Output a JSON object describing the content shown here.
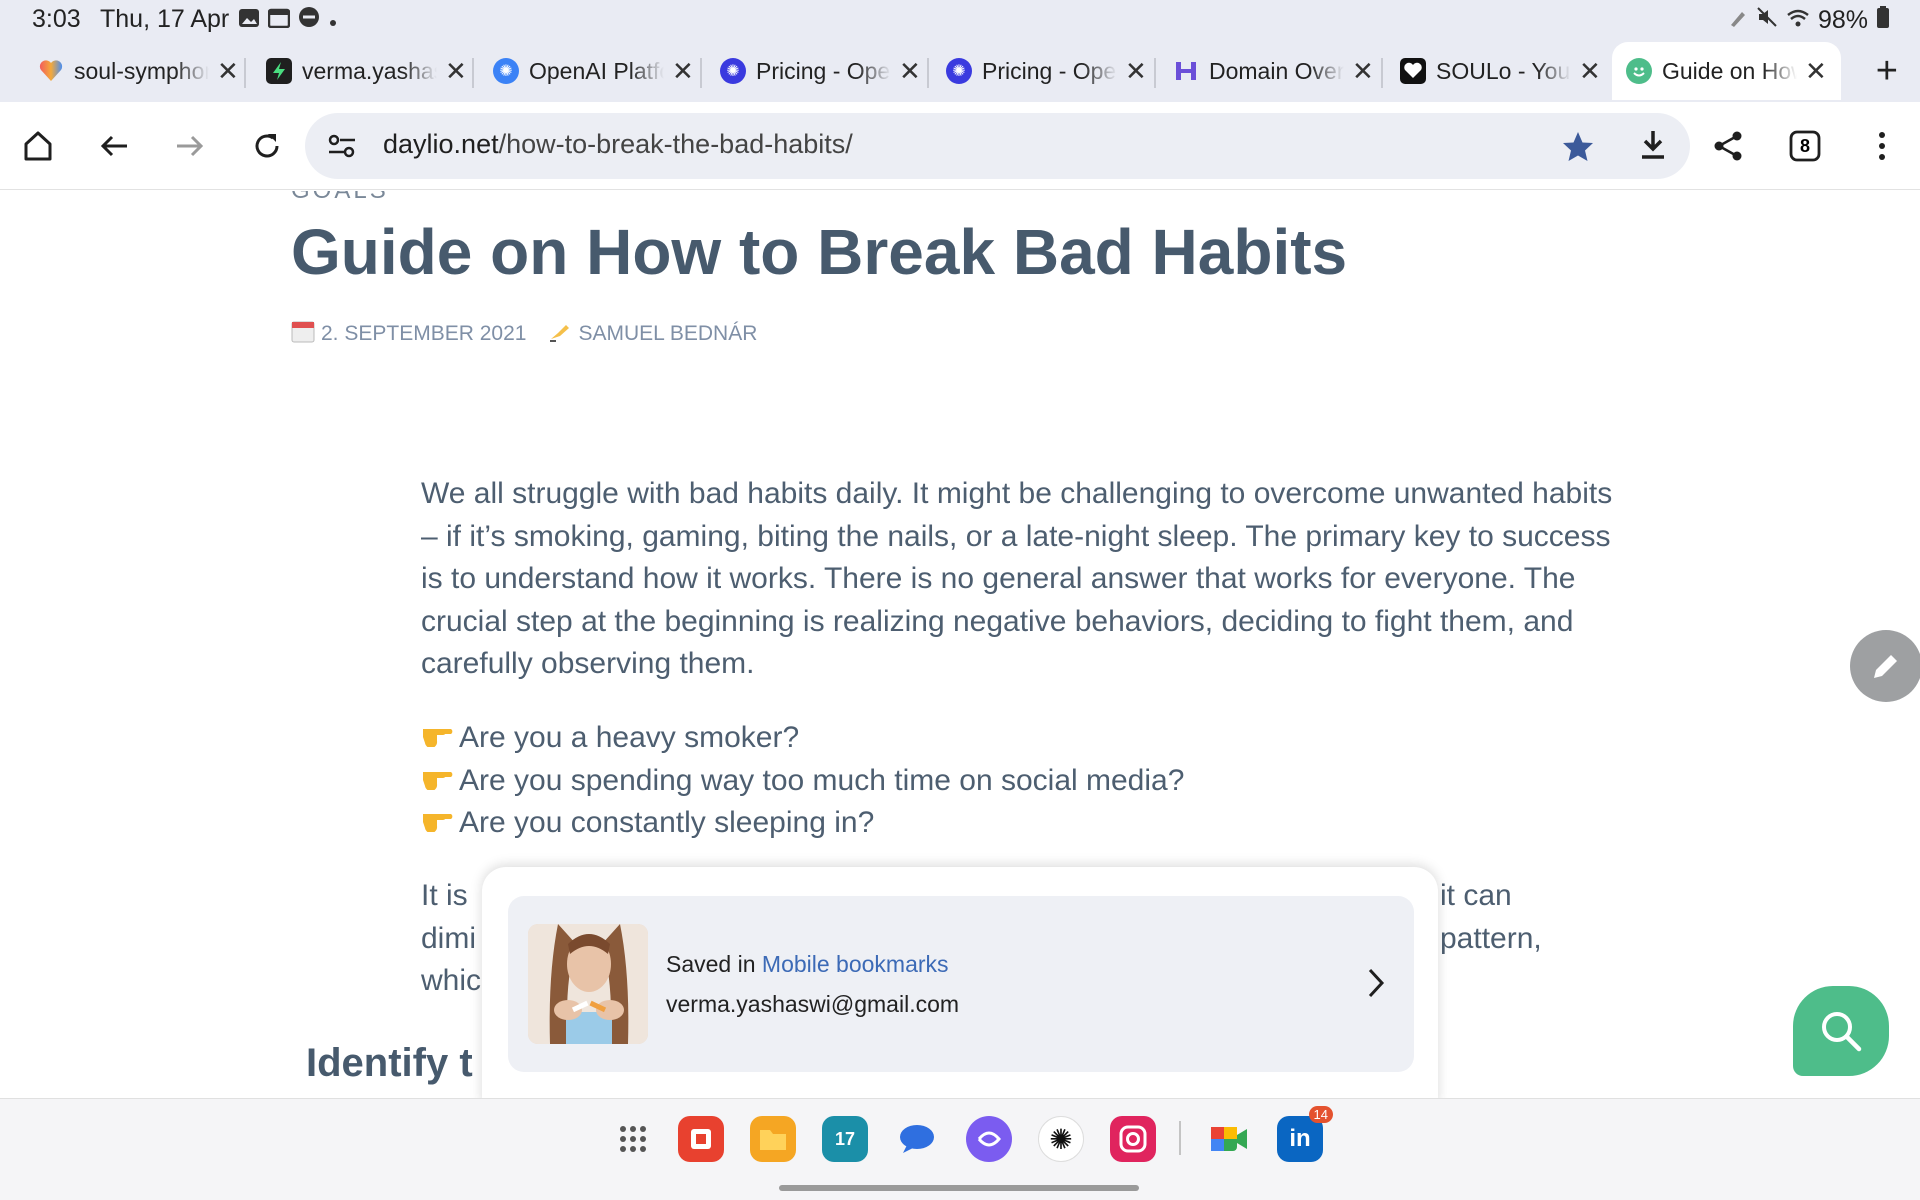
{
  "status_bar": {
    "time": "3:03",
    "date": "Thu, 17 Apr",
    "battery": "98%"
  },
  "tabs": [
    {
      "title": "soul-symphony",
      "favicon": "heart-icon",
      "color": "#e8523f"
    },
    {
      "title": "verma.yashaswi",
      "favicon": "bolt-icon",
      "color": "#1f1f1f"
    },
    {
      "title": "OpenAI Platform",
      "favicon": "openai-icon",
      "color": "#3b82f6"
    },
    {
      "title": "Pricing - OpenAI",
      "favicon": "openai-icon",
      "color": "#3a3adf"
    },
    {
      "title": "Pricing - OpenAI",
      "favicon": "openai-icon",
      "color": "#3a3adf"
    },
    {
      "title": "Domain Overview",
      "favicon": "semrush-icon",
      "color": "#6b4fd8"
    },
    {
      "title": "SOULo - Your",
      "favicon": "heart-outline-icon",
      "color": "#111111"
    },
    {
      "title": "Guide on How",
      "favicon": "daylio-icon",
      "color": "#4ebd8a"
    }
  ],
  "toolbar": {
    "url_domain": "daylio.net",
    "url_path": "/how-to-break-the-bad-habits/",
    "tab_count": "8"
  },
  "article": {
    "category": "GOALS",
    "title": "Guide on How to Break Bad Habits",
    "date": "2. SEPTEMBER 2021",
    "author": "SAMUEL BEDNÁR",
    "paragraph1": "We all struggle with bad habits daily. It might be challenging to overcome unwanted habits – if it’s smoking, gaming, biting the nails, or a late-night sleep. The primary key to success is to understand how it works. There is no general answer that works for everyone. The crucial step at the beginning is realizing negative behaviors, deciding to fight them, and carefully observing them.",
    "bullets": [
      "Are you a heavy smoker?",
      "Are you spending way too much time on social media?",
      "Are you constantly sleeping in?"
    ],
    "partial_left": [
      "It is",
      "dimi",
      "whic"
    ],
    "partial_right": [
      "it can",
      "pattern,"
    ],
    "heading_partial": "Identify t"
  },
  "bookmark_sheet": {
    "saved_prefix": "Saved in ",
    "folder": "Mobile bookmarks",
    "account": "verma.yashaswi@gmail.com"
  },
  "dock": {
    "linkedin_badge": "14",
    "calendar_day": "17"
  },
  "colors": {
    "title": "#475a6d",
    "body": "#4d5e70",
    "accent_green": "#4ebd8a",
    "link_blue": "#3c6ab6"
  }
}
